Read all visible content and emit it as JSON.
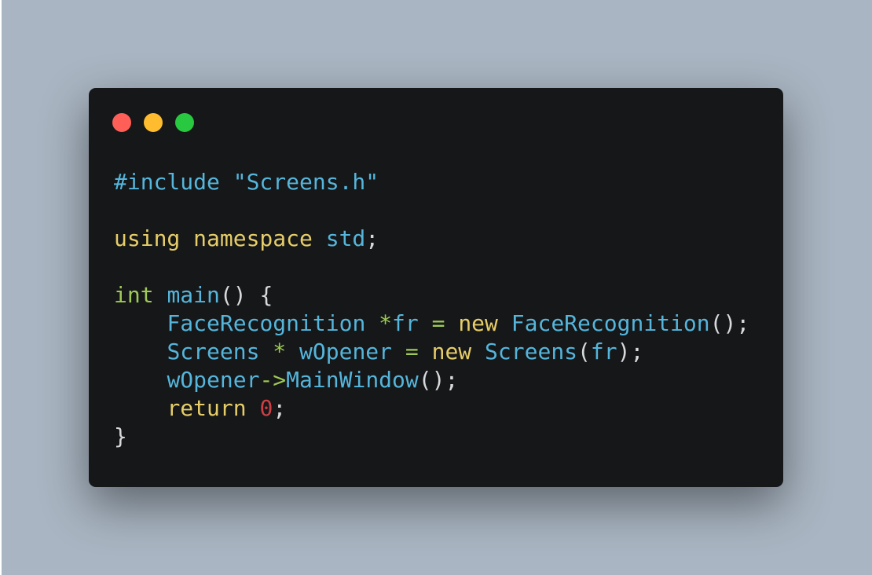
{
  "colors": {
    "background": "#a9b5c2",
    "window": "#151718",
    "red": "#ff5f57",
    "yellow": "#febc2e",
    "green": "#28c840",
    "blue": "#55b5db",
    "yellow_code": "#e6cd69",
    "green_code": "#9fca56",
    "red_code": "#cd3f45",
    "plain": "#d7dadc"
  },
  "window_controls": [
    {
      "name": "close-dot",
      "color": "#ff5f57"
    },
    {
      "name": "minimize-dot",
      "color": "#febc2e"
    },
    {
      "name": "maximize-dot",
      "color": "#28c840"
    }
  ],
  "code_lines": [
    [
      {
        "t": "#include \"Screens.h\"",
        "c": "#55b5db"
      }
    ],
    [],
    [
      {
        "t": "using namespace ",
        "c": "#e6cd69"
      },
      {
        "t": "std",
        "c": "#55b5db"
      },
      {
        "t": ";",
        "c": "#d7dadc"
      }
    ],
    [],
    [
      {
        "t": "int ",
        "c": "#9fca56"
      },
      {
        "t": "main",
        "c": "#55b5db"
      },
      {
        "t": "() {",
        "c": "#d7dadc"
      }
    ],
    [
      {
        "t": "    ",
        "c": "#d7dadc"
      },
      {
        "t": "FaceRecognition ",
        "c": "#55b5db"
      },
      {
        "t": "*",
        "c": "#9fca56"
      },
      {
        "t": "fr ",
        "c": "#55b5db"
      },
      {
        "t": "= ",
        "c": "#9fca56"
      },
      {
        "t": "new ",
        "c": "#e6cd69"
      },
      {
        "t": "FaceRecognition",
        "c": "#55b5db"
      },
      {
        "t": "();",
        "c": "#d7dadc"
      }
    ],
    [
      {
        "t": "    ",
        "c": "#d7dadc"
      },
      {
        "t": "Screens ",
        "c": "#55b5db"
      },
      {
        "t": "* ",
        "c": "#9fca56"
      },
      {
        "t": "wOpener ",
        "c": "#55b5db"
      },
      {
        "t": "= ",
        "c": "#9fca56"
      },
      {
        "t": "new ",
        "c": "#e6cd69"
      },
      {
        "t": "Screens",
        "c": "#55b5db"
      },
      {
        "t": "(",
        "c": "#d7dadc"
      },
      {
        "t": "fr",
        "c": "#55b5db"
      },
      {
        "t": ");",
        "c": "#d7dadc"
      }
    ],
    [
      {
        "t": "    ",
        "c": "#d7dadc"
      },
      {
        "t": "wOpener",
        "c": "#55b5db"
      },
      {
        "t": "->",
        "c": "#9fca56"
      },
      {
        "t": "MainWindow",
        "c": "#55b5db"
      },
      {
        "t": "();",
        "c": "#d7dadc"
      }
    ],
    [
      {
        "t": "    ",
        "c": "#d7dadc"
      },
      {
        "t": "return ",
        "c": "#e6cd69"
      },
      {
        "t": "0",
        "c": "#cd3f45"
      },
      {
        "t": ";",
        "c": "#d7dadc"
      }
    ],
    [
      {
        "t": "}",
        "c": "#d7dadc"
      }
    ]
  ]
}
